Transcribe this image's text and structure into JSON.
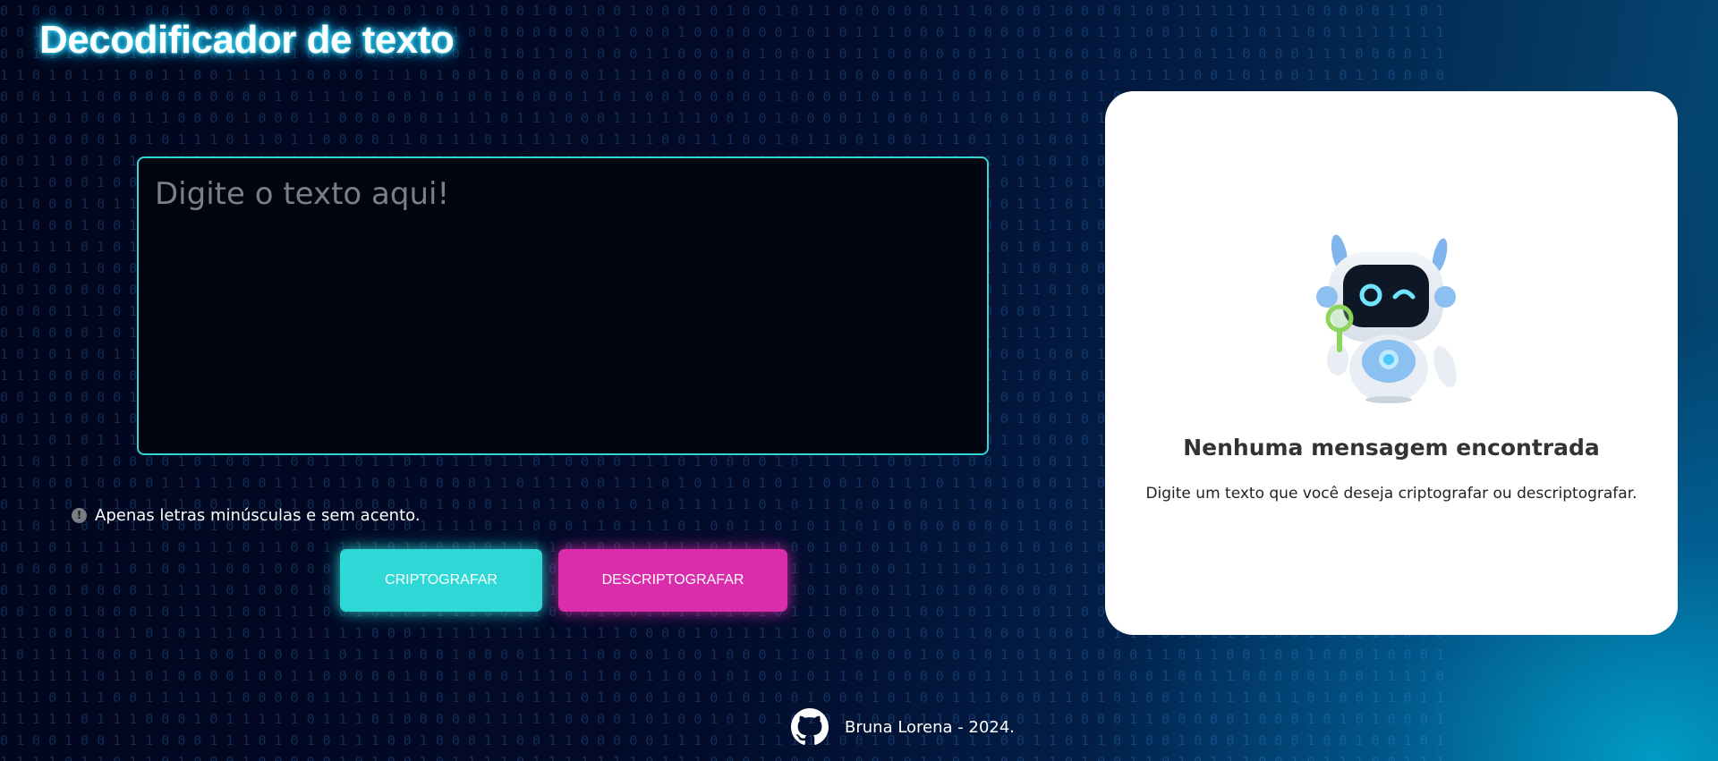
{
  "header": {
    "title": "Decodificador de texto"
  },
  "input": {
    "placeholder": "Digite o texto aqui!",
    "value": ""
  },
  "hint": {
    "icon": "info-icon",
    "text": "Apenas letras minúsculas e sem acento."
  },
  "buttons": {
    "encrypt_label": "CRIPTOGRAFAR",
    "decrypt_label": "DESCRIPTOGRAFAR"
  },
  "result": {
    "image": "robot-illustration",
    "title": "Nenhuma mensagem encontrada",
    "description": "Digite um texto que você deseja criptografar ou descriptografar."
  },
  "footer": {
    "icon": "github-icon",
    "text": "Bruna Lorena - 2024."
  },
  "colors": {
    "background": "#020b2a",
    "accent_cyan": "#2ed8d6",
    "accent_magenta": "#d92dab",
    "card": "#ffffff"
  }
}
